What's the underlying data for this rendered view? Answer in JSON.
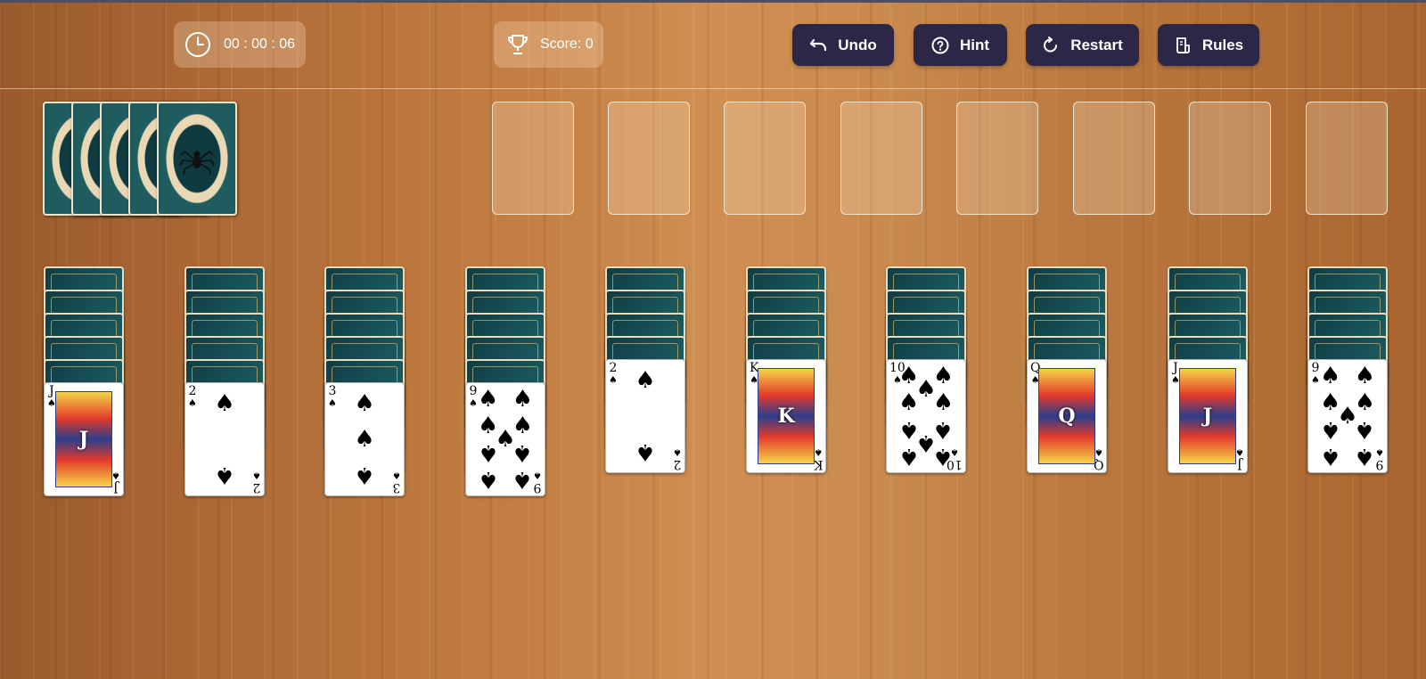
{
  "header": {
    "timer": {
      "value": "00 : 00 : 06",
      "icon": "clock-icon"
    },
    "score": {
      "label": "Score: 0",
      "icon": "trophy-icon"
    },
    "buttons": [
      {
        "label": "Undo",
        "icon": "undo-icon"
      },
      {
        "label": "Hint",
        "icon": "question-circle-icon"
      },
      {
        "label": "Restart",
        "icon": "restart-icon"
      },
      {
        "label": "Rules",
        "icon": "rules-icon"
      }
    ]
  },
  "stock": {
    "piles": 5
  },
  "foundations": {
    "count": 8
  },
  "tableau": [
    {
      "face_down": 5,
      "top": {
        "rank": "J",
        "suit": "♠"
      }
    },
    {
      "face_down": 5,
      "top": {
        "rank": "2",
        "suit": "♠"
      }
    },
    {
      "face_down": 5,
      "top": {
        "rank": "3",
        "suit": "♠"
      }
    },
    {
      "face_down": 5,
      "top": {
        "rank": "9",
        "suit": "♠"
      }
    },
    {
      "face_down": 4,
      "top": {
        "rank": "2",
        "suit": "♠"
      }
    },
    {
      "face_down": 4,
      "top": {
        "rank": "K",
        "suit": "♠"
      }
    },
    {
      "face_down": 4,
      "top": {
        "rank": "10",
        "suit": "♠"
      }
    },
    {
      "face_down": 4,
      "top": {
        "rank": "Q",
        "suit": "♠"
      }
    },
    {
      "face_down": 4,
      "top": {
        "rank": "J",
        "suit": "♠"
      }
    },
    {
      "face_down": 4,
      "top": {
        "rank": "9",
        "suit": "♠"
      }
    }
  ],
  "colors": {
    "button_bg": "#2c2747",
    "table_wood": "#c27d42"
  }
}
